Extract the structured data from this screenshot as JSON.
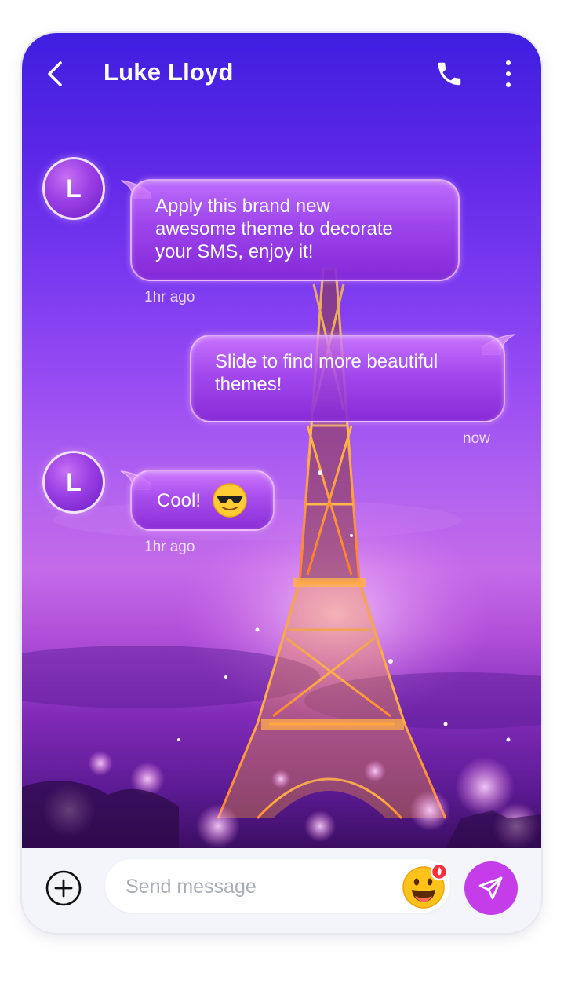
{
  "header": {
    "contact_name": "Luke Lloyd",
    "back_icon": "chevron-left-icon",
    "call_icon": "phone-icon",
    "more_icon": "more-vertical-icon"
  },
  "messages": [
    {
      "direction": "incoming",
      "avatar_letter": "L",
      "lines": [
        "Apply this brand new",
        "awesome theme to decorate",
        "your SMS, enjoy it!"
      ],
      "time": "1hr ago"
    },
    {
      "direction": "outgoing",
      "lines": [
        "Slide to find more beautiful",
        "themes!"
      ],
      "time": "now"
    },
    {
      "direction": "incoming",
      "avatar_letter": "L",
      "text": "Cool!",
      "emoji": "smiling-face-with-sunglasses",
      "time": "1hr ago"
    }
  ],
  "composer": {
    "placeholder": "Send message",
    "add_icon": "plus-circle-icon",
    "emoji_icon": "grinning-face-emoji-icon",
    "send_icon": "send-icon"
  },
  "colors": {
    "accent": "#c43de8",
    "bubble": "#a548ec",
    "composer_bg": "#f3f5fa",
    "sky_top": "#3f1fe0",
    "sky_bottom": "#3b0e62"
  }
}
